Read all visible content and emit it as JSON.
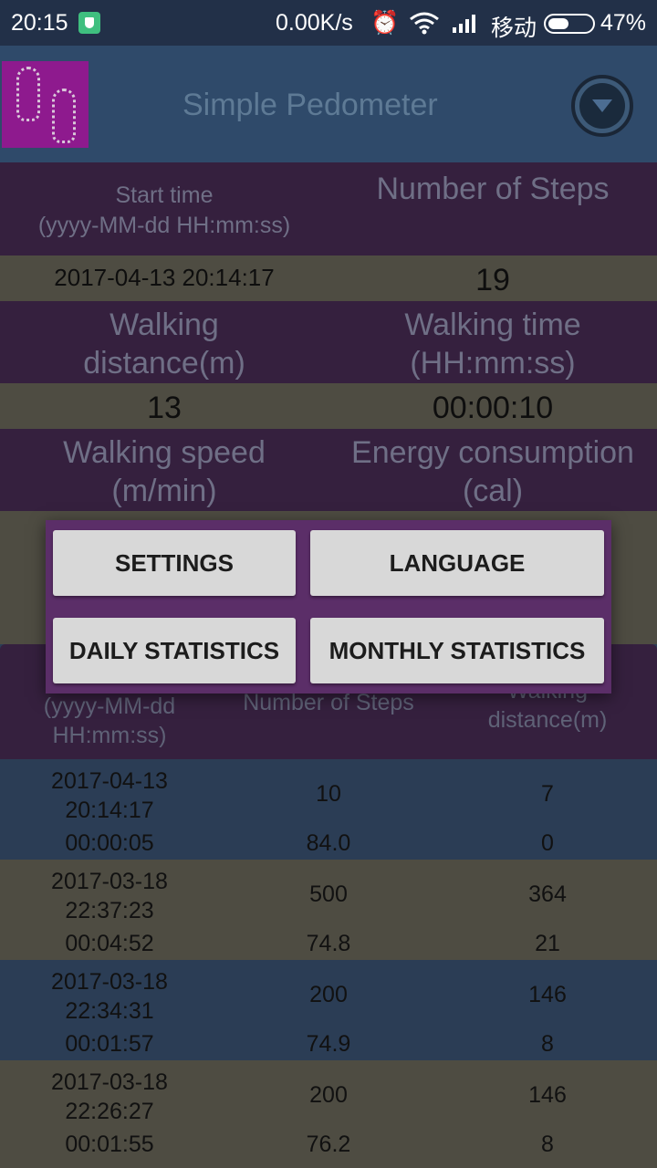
{
  "status_bar": {
    "time": "20:15",
    "net_speed": "0.00K/s",
    "carrier": "移动",
    "battery": "47%"
  },
  "header": {
    "title": "Simple Pedometer"
  },
  "summary": {
    "start_time_label_1": "Start time",
    "start_time_label_2": "(yyyy-MM-dd HH:mm:ss)",
    "steps_label": "Number of Steps",
    "start_time_value": "2017-04-13 20:14:17",
    "steps_value": "19",
    "distance_label_1": "Walking",
    "distance_label_2": "distance(m)",
    "time_label_1": "Walking time",
    "time_label_2": "(HH:mm:ss)",
    "distance_value": "13",
    "time_value": "00:00:10",
    "speed_label_1": "Walking speed",
    "speed_label_2": "(m/min)",
    "energy_label_1": "Energy consumption",
    "energy_label_2": "(cal)"
  },
  "menu": {
    "settings": "SETTINGS",
    "language": "LANGUAGE",
    "daily": "DAILY STATISTICS",
    "monthly": "MONTHLY STATISTICS"
  },
  "table": {
    "col1_line1": "(yyyy-MM-dd",
    "col1_line2": "HH:mm:ss)",
    "col2": "Number of Steps",
    "col3_line1": "Walking",
    "col3_line2": "distance(m)",
    "rows": [
      {
        "date": "2017-04-13",
        "time": "20:14:17",
        "duration": "00:00:05",
        "steps": "10",
        "speed": "84.0",
        "distance": "7",
        "energy": "0"
      },
      {
        "date": "2017-03-18",
        "time": "22:37:23",
        "duration": "00:04:52",
        "steps": "500",
        "speed": "74.8",
        "distance": "364",
        "energy": "21"
      },
      {
        "date": "2017-03-18",
        "time": "22:34:31",
        "duration": "00:01:57",
        "steps": "200",
        "speed": "74.9",
        "distance": "146",
        "energy": "8"
      },
      {
        "date": "2017-03-18",
        "time": "22:26:27",
        "duration": "00:01:55",
        "steps": "200",
        "speed": "76.2",
        "distance": "146",
        "energy": "8"
      }
    ]
  }
}
